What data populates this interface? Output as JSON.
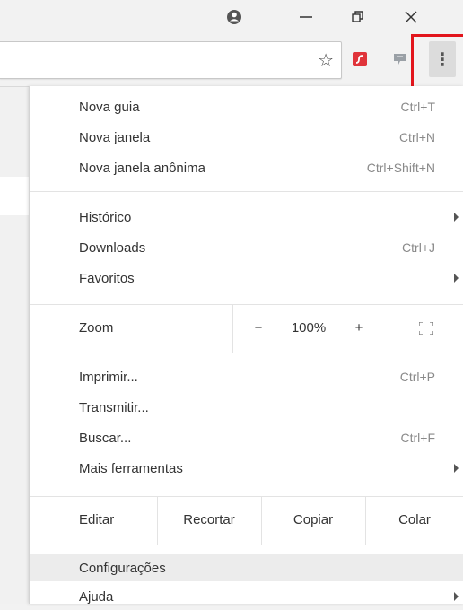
{
  "titlebar": {
    "profile_icon": "profile-icon",
    "minimize_glyph": "—",
    "restore_icon": "restore-icon",
    "close_glyph": "✕"
  },
  "toolbar": {
    "star_glyph": "☆",
    "extensions": [
      "flash-extension-icon",
      "gray-extension-icon"
    ],
    "menu_glyph": "⋮"
  },
  "menu": {
    "group1": [
      {
        "label": "Nova guia",
        "shortcut": "Ctrl+T"
      },
      {
        "label": "Nova janela",
        "shortcut": "Ctrl+N"
      },
      {
        "label": "Nova janela anônima",
        "shortcut": "Ctrl+Shift+N"
      }
    ],
    "group2": [
      {
        "label": "Histórico",
        "shortcut": ""
      },
      {
        "label": "Downloads",
        "shortcut": "Ctrl+J"
      },
      {
        "label": "Favoritos",
        "shortcut": ""
      }
    ],
    "zoom": {
      "label": "Zoom",
      "minus": "−",
      "value": "100%",
      "plus": "+"
    },
    "group3": [
      {
        "label": "Imprimir...",
        "shortcut": "Ctrl+P"
      },
      {
        "label": "Transmitir...",
        "shortcut": ""
      },
      {
        "label": "Buscar...",
        "shortcut": "Ctrl+F"
      },
      {
        "label": "Mais ferramentas",
        "shortcut": ""
      }
    ],
    "edit": {
      "label": "Editar",
      "cut": "Recortar",
      "copy": "Copiar",
      "paste": "Colar"
    },
    "group4": [
      {
        "label": "Configurações"
      },
      {
        "label": "Ajuda"
      }
    ]
  },
  "colors": {
    "highlight_border": "#e2151c",
    "flash_red": "#e0343a"
  }
}
